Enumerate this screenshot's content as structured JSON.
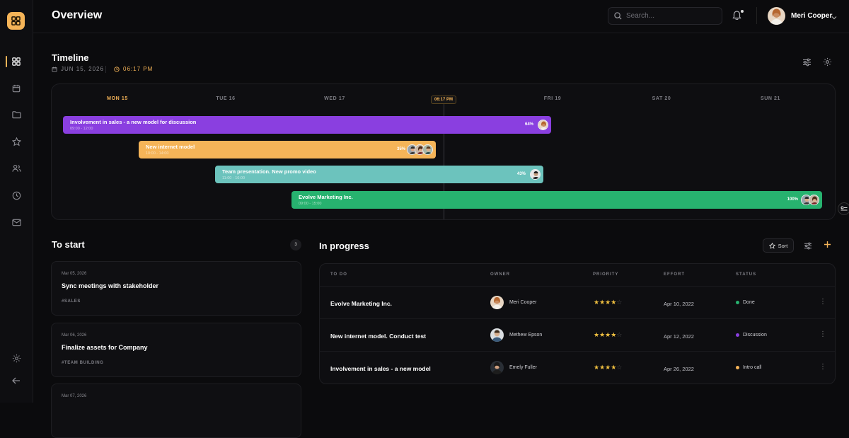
{
  "colors": {
    "accent": "#f5b458",
    "purple": "#8a3fe0",
    "amber": "#f5b458",
    "teal": "#6cc3bd",
    "green": "#27b26f",
    "done": "#27b26f",
    "discussion": "#8a3fe0",
    "intro": "#f5b458"
  },
  "sidebar": {
    "items": [
      {
        "name": "dashboard",
        "icon": "grid-icon"
      },
      {
        "name": "calendar",
        "icon": "calendar-icon"
      },
      {
        "name": "files",
        "icon": "folder-icon"
      },
      {
        "name": "favorites",
        "icon": "star-icon"
      },
      {
        "name": "team",
        "icon": "users-icon"
      },
      {
        "name": "history",
        "icon": "clock-icon"
      },
      {
        "name": "mail",
        "icon": "mail-icon"
      }
    ]
  },
  "header": {
    "title": "Overview",
    "search_placeholder": "Search...",
    "user_name": "Meri Cooper"
  },
  "timeline": {
    "title": "Timeline",
    "date": "JUN 15, 2026",
    "time": "06:17 PM",
    "now_label": "06:17 PM",
    "days": [
      "MON 15",
      "TUE 16",
      "WED 17",
      "THU 18",
      "FRI 19",
      "SAT 20",
      "SUN 21"
    ],
    "tasks": [
      {
        "title": "Involvement in sales - a new model for discussion",
        "time": "09:00 - 12:00",
        "percent": "64%"
      },
      {
        "title": "New internet model",
        "time": "10:00 - 14:00",
        "percent": "35%"
      },
      {
        "title": "Team presentation. New promo video",
        "time": "11:00 - 16:00",
        "percent": "43%"
      },
      {
        "title": "Evolve Marketing Inc.",
        "time": "09:00 - 15:00",
        "percent": "100%"
      }
    ]
  },
  "to_start": {
    "title": "To start",
    "count": "3",
    "cards": [
      {
        "date": "Mar 05, 2026",
        "title": "Sync meetings with stakeholder",
        "tag": "#SALES"
      },
      {
        "date": "Mar 06, 2026",
        "title": "Finalize assets for Company",
        "tag": "#TEAM BUILDING"
      },
      {
        "date": "Mar 07, 2026",
        "title": "",
        "tag": ""
      }
    ]
  },
  "in_progress": {
    "title": "In progress",
    "sort_label": "Sort",
    "columns": [
      "TO DO",
      "OWNER",
      "PRIORITY",
      "EFFORT",
      "STATUS"
    ],
    "rows": [
      {
        "todo": "Evolve Marketing Inc.",
        "owner": "Meri Cooper",
        "priority": 4,
        "effort": "Apr 10, 2022",
        "status": "Done"
      },
      {
        "todo": "New internet model. Conduct test",
        "owner": "Methew Epson",
        "priority": 4,
        "effort": "Apr 12, 2022",
        "status": "Discussion"
      },
      {
        "todo": "Involvement in sales - a new model",
        "owner": "Emely Fuller",
        "priority": 4,
        "effort": "Apr 26, 2022",
        "status": "Intro call"
      }
    ]
  }
}
